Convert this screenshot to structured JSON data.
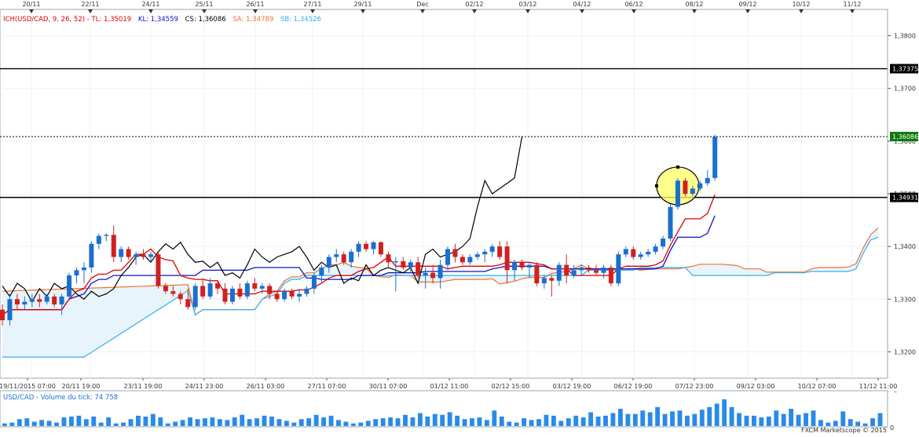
{
  "colors": {
    "tenkan": "#e00000",
    "kijun": "#1010c8",
    "chikou": "#000000",
    "senkou_a": "#f07030",
    "senkou_b": "#30b0e8",
    "cloud_fill": "#e8f4fc",
    "bull_candle": "#1a6fd0",
    "bear_candle": "#d02020",
    "volume_bar": "#2a8ae8",
    "price_badge": "#000000",
    "current_badge": "#0a7a0a",
    "highlight": "#ffff66"
  },
  "legend": {
    "ich": "ICH(USD/CAD, 9, 26, 52) - ",
    "tl": "TL: 1,35019",
    "kl": "KL: 1,34559",
    "cs": "CS: 1,36086",
    "sa": "SA: 1,34789",
    "sb": "SB: 1,34526"
  },
  "volume_label": "USD/CAD - Volume du tick: 74 758",
  "watermark": "FXCM Marketscope © 2015",
  "price_badges": {
    "level_high": "1,37375",
    "current": "1,36086",
    "level_low": "1,34931"
  },
  "chart_data": {
    "type": "candlestick",
    "symbol": "USD/CAD",
    "ylim": [
      1.315,
      1.385
    ],
    "y_ticks": [
      "1,3200",
      "1,3300",
      "1,3400",
      "1,3500",
      "1,3600",
      "1,3700",
      "1,3800"
    ],
    "top_dates": [
      "20/11",
      "22/11",
      "24/11",
      "25/11",
      "26/11",
      "27/11",
      "29/11",
      "Dec",
      "02/12",
      "03/12",
      "04/12",
      "06/12",
      "08/12",
      "09/12",
      "10/12",
      "11/12"
    ],
    "bottom_times": [
      "19/11/2015 07:00",
      "20/11 19:00",
      "23/11 19:00",
      "24/11 23:00",
      "26/11 03:00",
      "27/11 07:00",
      "30/11 07:00",
      "01/12 11:00",
      "02/12 15:00",
      "03/12 19:00",
      "06/12 19:00",
      "07/12 23:00",
      "09/12 03:00",
      "10/12 07:00",
      "11/12 11:00"
    ],
    "horizontal_levels": [
      1.37375,
      1.34931
    ],
    "current_price": 1.36086,
    "candles": [
      [
        1.328,
        1.329,
        1.325,
        1.326
      ],
      [
        1.326,
        1.331,
        1.325,
        1.33
      ],
      [
        1.33,
        1.331,
        1.328,
        1.329
      ],
      [
        1.329,
        1.3305,
        1.328,
        1.3295
      ],
      [
        1.3295,
        1.331,
        1.3285,
        1.33
      ],
      [
        1.33,
        1.331,
        1.3285,
        1.3295
      ],
      [
        1.3295,
        1.331,
        1.329,
        1.3305
      ],
      [
        1.3305,
        1.331,
        1.3285,
        1.329
      ],
      [
        1.329,
        1.331,
        1.327,
        1.3305
      ],
      [
        1.3305,
        1.335,
        1.33,
        1.3345
      ],
      [
        1.3345,
        1.336,
        1.333,
        1.3355
      ],
      [
        1.3355,
        1.337,
        1.333,
        1.336
      ],
      [
        1.336,
        1.341,
        1.335,
        1.3405
      ],
      [
        1.3405,
        1.3425,
        1.3395,
        1.342
      ],
      [
        1.342,
        1.3425,
        1.341,
        1.3422
      ],
      [
        1.3422,
        1.344,
        1.337,
        1.338
      ],
      [
        1.338,
        1.34,
        1.337,
        1.3395
      ],
      [
        1.3395,
        1.34,
        1.3375,
        1.338
      ],
      [
        1.338,
        1.339,
        1.3365,
        1.3385
      ],
      [
        1.3385,
        1.3395,
        1.3375,
        1.338
      ],
      [
        1.338,
        1.339,
        1.337,
        1.3385
      ],
      [
        1.3385,
        1.339,
        1.332,
        1.3325
      ],
      [
        1.3325,
        1.333,
        1.331,
        1.3315
      ],
      [
        1.3315,
        1.3325,
        1.3305,
        1.331
      ],
      [
        1.331,
        1.3315,
        1.329,
        1.33
      ],
      [
        1.33,
        1.332,
        1.328,
        1.3285
      ],
      [
        1.3285,
        1.333,
        1.328,
        1.3325
      ],
      [
        1.3325,
        1.334,
        1.33,
        1.3305
      ],
      [
        1.3305,
        1.334,
        1.33,
        1.333
      ],
      [
        1.333,
        1.3335,
        1.331,
        1.332
      ],
      [
        1.332,
        1.333,
        1.329,
        1.3295
      ],
      [
        1.3295,
        1.3325,
        1.329,
        1.332
      ],
      [
        1.332,
        1.333,
        1.33,
        1.3305
      ],
      [
        1.3305,
        1.3335,
        1.33,
        1.333
      ],
      [
        1.333,
        1.334,
        1.3315,
        1.332
      ],
      [
        1.332,
        1.333,
        1.331,
        1.3325
      ],
      [
        1.3325,
        1.333,
        1.33,
        1.331
      ],
      [
        1.331,
        1.3315,
        1.3295,
        1.33
      ],
      [
        1.33,
        1.332,
        1.3295,
        1.3315
      ],
      [
        1.3315,
        1.332,
        1.33,
        1.3305
      ],
      [
        1.3305,
        1.332,
        1.3295,
        1.331
      ],
      [
        1.331,
        1.3325,
        1.3305,
        1.332
      ],
      [
        1.332,
        1.335,
        1.331,
        1.3345
      ],
      [
        1.3345,
        1.3365,
        1.333,
        1.336
      ],
      [
        1.336,
        1.3385,
        1.335,
        1.338
      ],
      [
        1.338,
        1.3395,
        1.337,
        1.3385
      ],
      [
        1.3385,
        1.339,
        1.3365,
        1.337
      ],
      [
        1.337,
        1.3395,
        1.336,
        1.339
      ],
      [
        1.339,
        1.341,
        1.338,
        1.3405
      ],
      [
        1.3405,
        1.341,
        1.339,
        1.3395
      ],
      [
        1.3395,
        1.341,
        1.3385,
        1.3408
      ],
      [
        1.3408,
        1.341,
        1.338,
        1.3385
      ],
      [
        1.3385,
        1.339,
        1.336,
        1.337
      ],
      [
        1.337,
        1.338,
        1.3315,
        1.3372
      ],
      [
        1.3372,
        1.338,
        1.3355,
        1.336
      ],
      [
        1.336,
        1.3375,
        1.335,
        1.337
      ],
      [
        1.337,
        1.338,
        1.334,
        1.3345
      ],
      [
        1.3345,
        1.336,
        1.332,
        1.335
      ],
      [
        1.335,
        1.3365,
        1.333,
        1.334
      ],
      [
        1.334,
        1.3375,
        1.332,
        1.3365
      ],
      [
        1.3365,
        1.34,
        1.3355,
        1.3395
      ],
      [
        1.3395,
        1.3405,
        1.337,
        1.338
      ],
      [
        1.338,
        1.3385,
        1.3365,
        1.337
      ],
      [
        1.337,
        1.3385,
        1.3365,
        1.338
      ],
      [
        1.338,
        1.339,
        1.3375,
        1.3385
      ],
      [
        1.3385,
        1.3395,
        1.337,
        1.339
      ],
      [
        1.339,
        1.3405,
        1.338,
        1.34
      ],
      [
        1.34,
        1.341,
        1.3375,
        1.338
      ],
      [
        1.34,
        1.341,
        1.333,
        1.3355
      ],
      [
        1.3355,
        1.3375,
        1.3335,
        1.337
      ],
      [
        1.337,
        1.3375,
        1.3355,
        1.336
      ],
      [
        1.336,
        1.337,
        1.334,
        1.3365
      ],
      [
        1.3365,
        1.337,
        1.3325,
        1.333
      ],
      [
        1.333,
        1.3345,
        1.332,
        1.334
      ],
      [
        1.334,
        1.3345,
        1.3305,
        1.3335
      ],
      [
        1.3335,
        1.337,
        1.3325,
        1.3365
      ],
      [
        1.3365,
        1.3385,
        1.333,
        1.3345
      ],
      [
        1.3345,
        1.3365,
        1.334,
        1.3355
      ],
      [
        1.3355,
        1.3365,
        1.3345,
        1.336
      ],
      [
        1.336,
        1.3365,
        1.335,
        1.3355
      ],
      [
        1.3355,
        1.3365,
        1.3345,
        1.335
      ],
      [
        1.335,
        1.3365,
        1.334,
        1.336
      ],
      [
        1.336,
        1.3365,
        1.3325,
        1.333
      ],
      [
        1.333,
        1.339,
        1.3325,
        1.3385
      ],
      [
        1.3385,
        1.34,
        1.338,
        1.3395
      ],
      [
        1.3395,
        1.34,
        1.3375,
        1.338
      ],
      [
        1.338,
        1.339,
        1.3375,
        1.3385
      ],
      [
        1.3385,
        1.3395,
        1.338,
        1.339
      ],
      [
        1.339,
        1.3405,
        1.3385,
        1.34
      ],
      [
        1.34,
        1.342,
        1.3395,
        1.3415
      ],
      [
        1.3415,
        1.348,
        1.341,
        1.3475
      ],
      [
        1.3475,
        1.353,
        1.347,
        1.3525
      ],
      [
        1.3525,
        1.353,
        1.3495,
        1.35
      ],
      [
        1.35,
        1.3515,
        1.3495,
        1.351
      ],
      [
        1.351,
        1.3525,
        1.3505,
        1.352
      ],
      [
        1.352,
        1.3545,
        1.3515,
        1.353
      ],
      [
        1.353,
        1.3612,
        1.3525,
        1.3608
      ]
    ],
    "volume": [
      3,
      4,
      8,
      9,
      5,
      7,
      6,
      4,
      10,
      11,
      12,
      8,
      11,
      4,
      10,
      3,
      4,
      8,
      12,
      11,
      14,
      10,
      3,
      5,
      7,
      10,
      8,
      9,
      10,
      8,
      7,
      10,
      13,
      8,
      9,
      12,
      11,
      8,
      6,
      4,
      8,
      9,
      13,
      10,
      12,
      7,
      5,
      3,
      4,
      6,
      8,
      9,
      10,
      9,
      13,
      10,
      15,
      11,
      14,
      13,
      16,
      12,
      8,
      9,
      10,
      7,
      18,
      11,
      5,
      4,
      9,
      7,
      8,
      13,
      12,
      6,
      9,
      12,
      10,
      16,
      11,
      12,
      15,
      20,
      14,
      14,
      18,
      16,
      22,
      14,
      17,
      18,
      12,
      14,
      19,
      22,
      26,
      31,
      22,
      15,
      12,
      12,
      10,
      11,
      18,
      14,
      20,
      13,
      15,
      18,
      7,
      4,
      6,
      17,
      8,
      5,
      3,
      9,
      15
    ]
  }
}
